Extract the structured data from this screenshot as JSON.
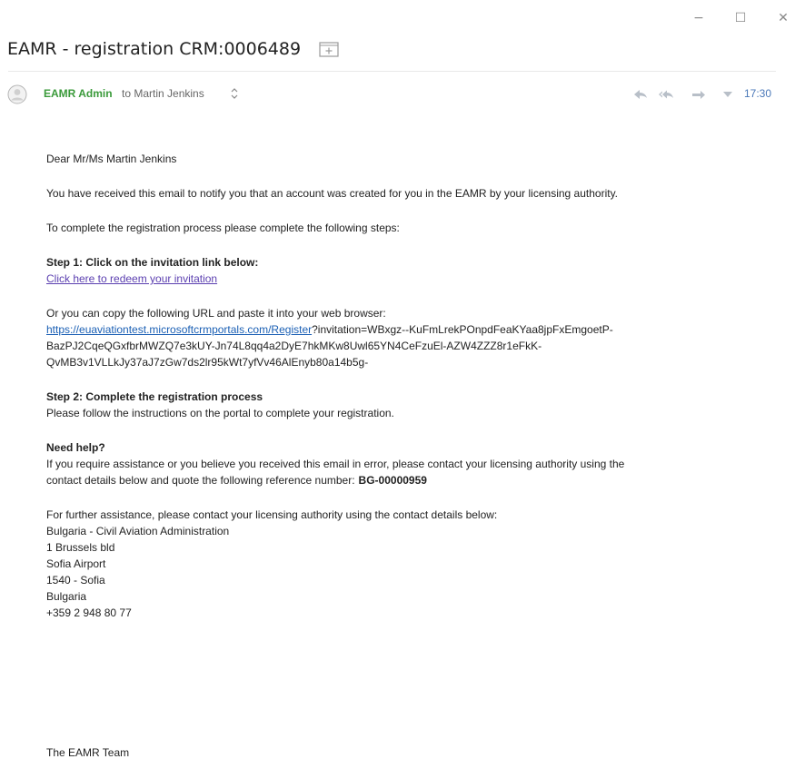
{
  "window": {
    "minimize_glyph": "−",
    "maximize_glyph": "☐",
    "close_glyph": "✕"
  },
  "message": {
    "subject": "EAMR - registration CRM:0006489",
    "folder_icon": "add-to-folder-icon",
    "sender": "EAMR Admin",
    "to_text": "to Martin Jenkins",
    "time": "17:30",
    "icons": [
      "reply-icon",
      "reply-all-icon",
      "forward-icon",
      "more-icon"
    ]
  },
  "body": {
    "greeting": "Dear Mr/Ms Martin Jenkins",
    "intro": "You have received this email to notify you that an account was created for you in the EAMR by your licensing authority.",
    "steps_intro": "To complete the registration process please complete the following steps:",
    "step1_title": "Step 1: Click on the invitation link below:",
    "step1_link": "Click here to redeem your invitation",
    "copy_url_text": "Or you can copy the following URL and paste it into your web browser:",
    "url_link": "https://euaviationtest.microsoftcrmportals.com/Register",
    "url_line1_rest": "?invitation=WBxgz--KuFmLrekPOnpdFeaKYaa8jpFxEmgoetP-",
    "url_line2": "BazPJ2CqeQGxfbrMWZQ7e3kUY-Jn74L8qq4a2DyE7hkMKw8Uwl65YN4CeFzuEl-AZW4ZZZ8r1eFkK-",
    "url_line3": "QvMB3v1VLLkJy37aJ7zGw7ds2lr95kWt7yfVv46AlEnyb80a14b5g-",
    "step2_title": "Step 2: Complete the registration process",
    "step2_text": "Please follow the instructions on the portal to complete your registration.",
    "help_title": "Need help?",
    "help_line1": "If you require assistance or you believe you received this email in error, please contact your licensing authority using the",
    "help_line2": "contact details below and quote the following reference number:",
    "reference_number": "BG-00000959",
    "further_text": "For further assistance, please contact your licensing authority using the contact details below:",
    "authority_name": "Bulgaria - Civil Aviation Administration",
    "address1": "1 Brussels bld",
    "address2": "Sofia Airport",
    "address3": "1540 -  Sofia",
    "country": "Bulgaria",
    "phone": "+359 2 948 80 77",
    "signature": "The EAMR Team"
  }
}
